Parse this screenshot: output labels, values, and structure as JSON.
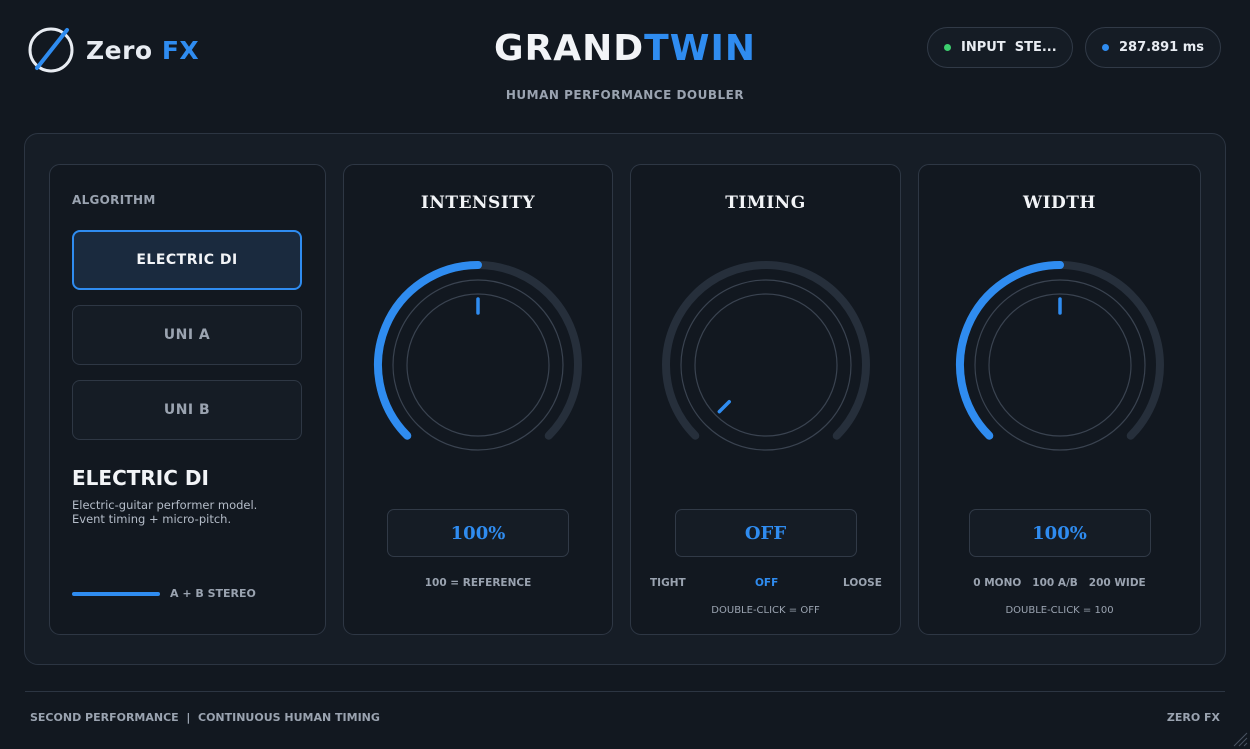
{
  "header": {
    "brand_name": "Zero",
    "brand_accent": "FX",
    "title_part1": "GRAND",
    "title_part2": "TWIN",
    "subtitle": "HUMAN PERFORMANCE DOUBLER",
    "input_status": "INPUT  STE...",
    "latency": "287.891 ms",
    "input_dot_color": "#3ccf6e",
    "latency_dot_color": "#2f8cf0"
  },
  "algorithm": {
    "heading": "ALGORITHM",
    "options": [
      "ELECTRIC DI",
      "UNI A",
      "UNI B"
    ],
    "selected": "ELECTRIC DI",
    "title": "ELECTRIC DI",
    "description_line1": "Electric-guitar performer model.",
    "description_line2": "Event timing + micro-pitch.",
    "mode_label": "A + B STEREO"
  },
  "intensity": {
    "title": "INTENSITY",
    "value": "100%",
    "hint": "100 = REFERENCE",
    "knob_fraction": 0.5
  },
  "timing": {
    "title": "TIMING",
    "value": "OFF",
    "scale_left": "TIGHT",
    "scale_mid": "OFF",
    "scale_right": "LOOSE",
    "hint": "DOUBLE-CLICK = OFF",
    "knob_fraction": 0
  },
  "width": {
    "title": "WIDTH",
    "value": "100%",
    "scale": "0 MONO   100 A/B   200 WIDE",
    "hint": "DOUBLE-CLICK = 100",
    "knob_fraction": 0.5
  },
  "footer": {
    "left": "SECOND PERFORMANCE  |  CONTINUOUS HUMAN TIMING",
    "right": "ZERO FX"
  },
  "colors": {
    "accent": "#2f8cf0",
    "track": "#262f3b",
    "background": "#121820"
  }
}
